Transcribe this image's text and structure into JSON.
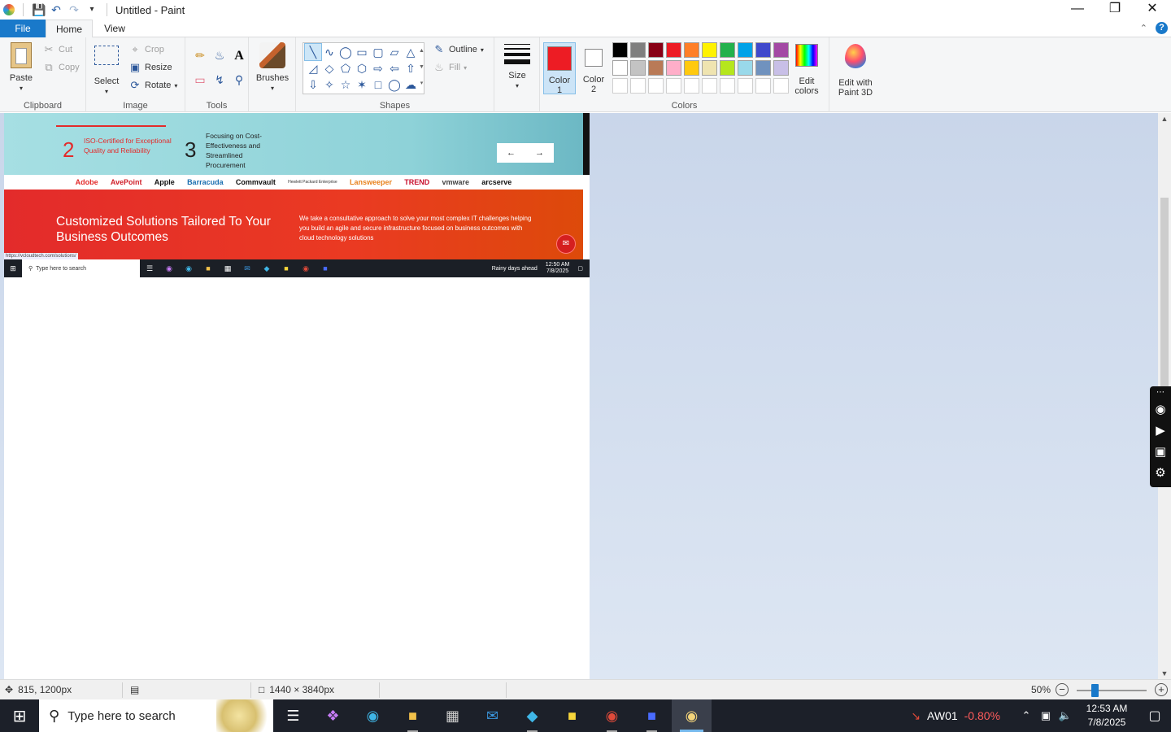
{
  "window": {
    "title": "Untitled - Paint",
    "controls": {
      "minimize": "—",
      "maximize": "❐",
      "close": "✕"
    }
  },
  "tabs": {
    "file": "File",
    "home": "Home",
    "view": "View"
  },
  "ribbon": {
    "clipboard": {
      "label": "Clipboard",
      "paste": "Paste",
      "cut": "Cut",
      "copy": "Copy"
    },
    "image": {
      "label": "Image",
      "select": "Select",
      "crop": "Crop",
      "resize": "Resize",
      "rotate": "Rotate"
    },
    "tools": {
      "label": "Tools"
    },
    "brushes": {
      "label": "Brushes"
    },
    "shapes": {
      "label": "Shapes",
      "outline": "Outline",
      "fill": "Fill"
    },
    "size": {
      "label": "Size"
    },
    "colors": {
      "label": "Colors",
      "color1_line1": "Color",
      "color1_line2": "1",
      "color2_line1": "Color",
      "color2_line2": "2",
      "edit_colors_line1": "Edit",
      "edit_colors_line2": "colors",
      "color1_value": "#ed1c24",
      "color2_value": "#ffffff",
      "palette_row1": [
        "#000000",
        "#7f7f7f",
        "#880015",
        "#ed1c24",
        "#ff7f27",
        "#fff200",
        "#22b14c",
        "#00a2e8",
        "#3f48cc",
        "#a349a4"
      ],
      "palette_row2": [
        "#ffffff",
        "#c3c3c3",
        "#b97a57",
        "#ffaec9",
        "#ffc90e",
        "#efe4b0",
        "#b5e61d",
        "#99d9ea",
        "#7092be",
        "#c8bfe7"
      ]
    },
    "paint3d": {
      "line1": "Edit with",
      "line2": "Paint 3D"
    }
  },
  "canvas_content": {
    "stat2_num": "2",
    "stat2_text": "ISO-Certified for Exceptional Quality and Reliability",
    "stat3_num": "3",
    "stat3_text": "Focusing on Cost-Effectiveness and Streamlined Procurement",
    "prev_arrow": "←",
    "next_arrow": "→",
    "logos": [
      "Adobe",
      "AvePoint",
      "Apple",
      "Barracuda",
      "Commvault",
      "Hewlett Packard Enterprise",
      "Lansweeper",
      "TREND",
      "vmware",
      "arcserve"
    ],
    "hero_title": "Customized Solutions Tailored To Your Business Outcomes",
    "hero_text": "We take a consultative approach to solve your most complex IT challenges helping you build an agile and secure infrastructure focused on business outcomes with cloud technology solutions",
    "url_tip": "https://vcloudtech.com/solutions/",
    "inner_search": "Type here to search",
    "inner_weather": "Rainy days ahead",
    "inner_time": "12:50 AM",
    "inner_date": "7/8/2025"
  },
  "status": {
    "cursor_pos": "815, 1200px",
    "image_size": "1440 × 3840px",
    "zoom": "50%",
    "zoom_fraction": 0.25
  },
  "taskbar": {
    "search_placeholder": "Type here to search",
    "stock_name": "AW01",
    "stock_change": "-0.80%",
    "time": "12:53 AM",
    "date": "7/8/2025"
  }
}
